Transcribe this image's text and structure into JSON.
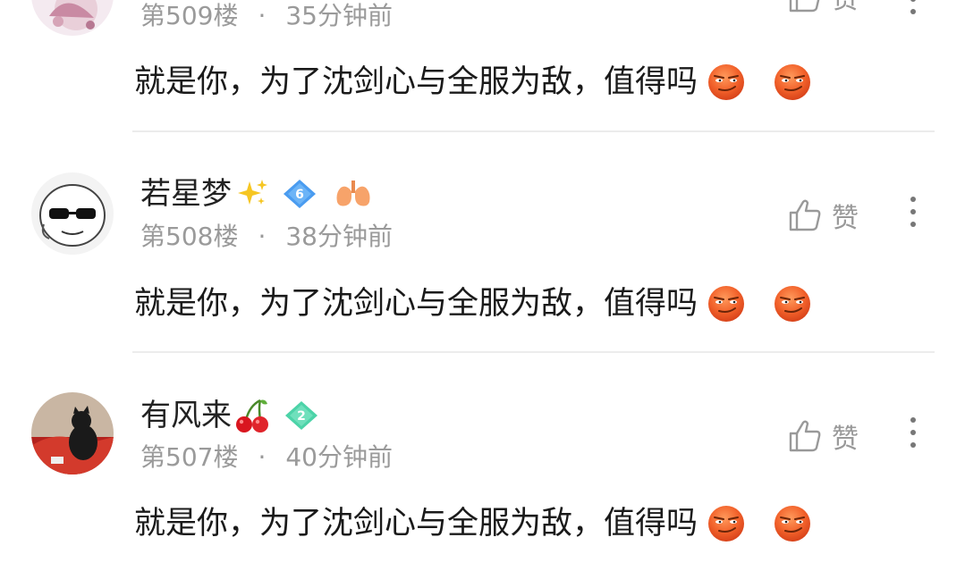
{
  "comments": [
    {
      "floor": "第509楼",
      "time": "35分钟前",
      "text": "就是你，为了沈剑心与全服为敌，值得吗",
      "like_label": "赞",
      "emojis": [
        "smirk-face",
        "smirk-face"
      ]
    },
    {
      "username": "若星梦",
      "level": "6",
      "floor": "第508楼",
      "time": "38分钟前",
      "text": "就是你，为了沈剑心与全服为敌，值得吗",
      "like_label": "赞",
      "emojis": [
        "smirk-face",
        "smirk-face"
      ]
    },
    {
      "username": "有风来",
      "level": "2",
      "floor": "第507楼",
      "time": "40分钟前",
      "text": "就是你，为了沈剑心与全服为敌，值得吗",
      "like_label": "赞",
      "emojis": [
        "smirk-face",
        "smirk-face"
      ]
    }
  ],
  "separator": "·",
  "colors": {
    "level6_badge": "#4a9cf0",
    "level2_badge": "#4cd3a8",
    "emoji": "#f2622b",
    "meta_text": "#9a9a9a"
  }
}
